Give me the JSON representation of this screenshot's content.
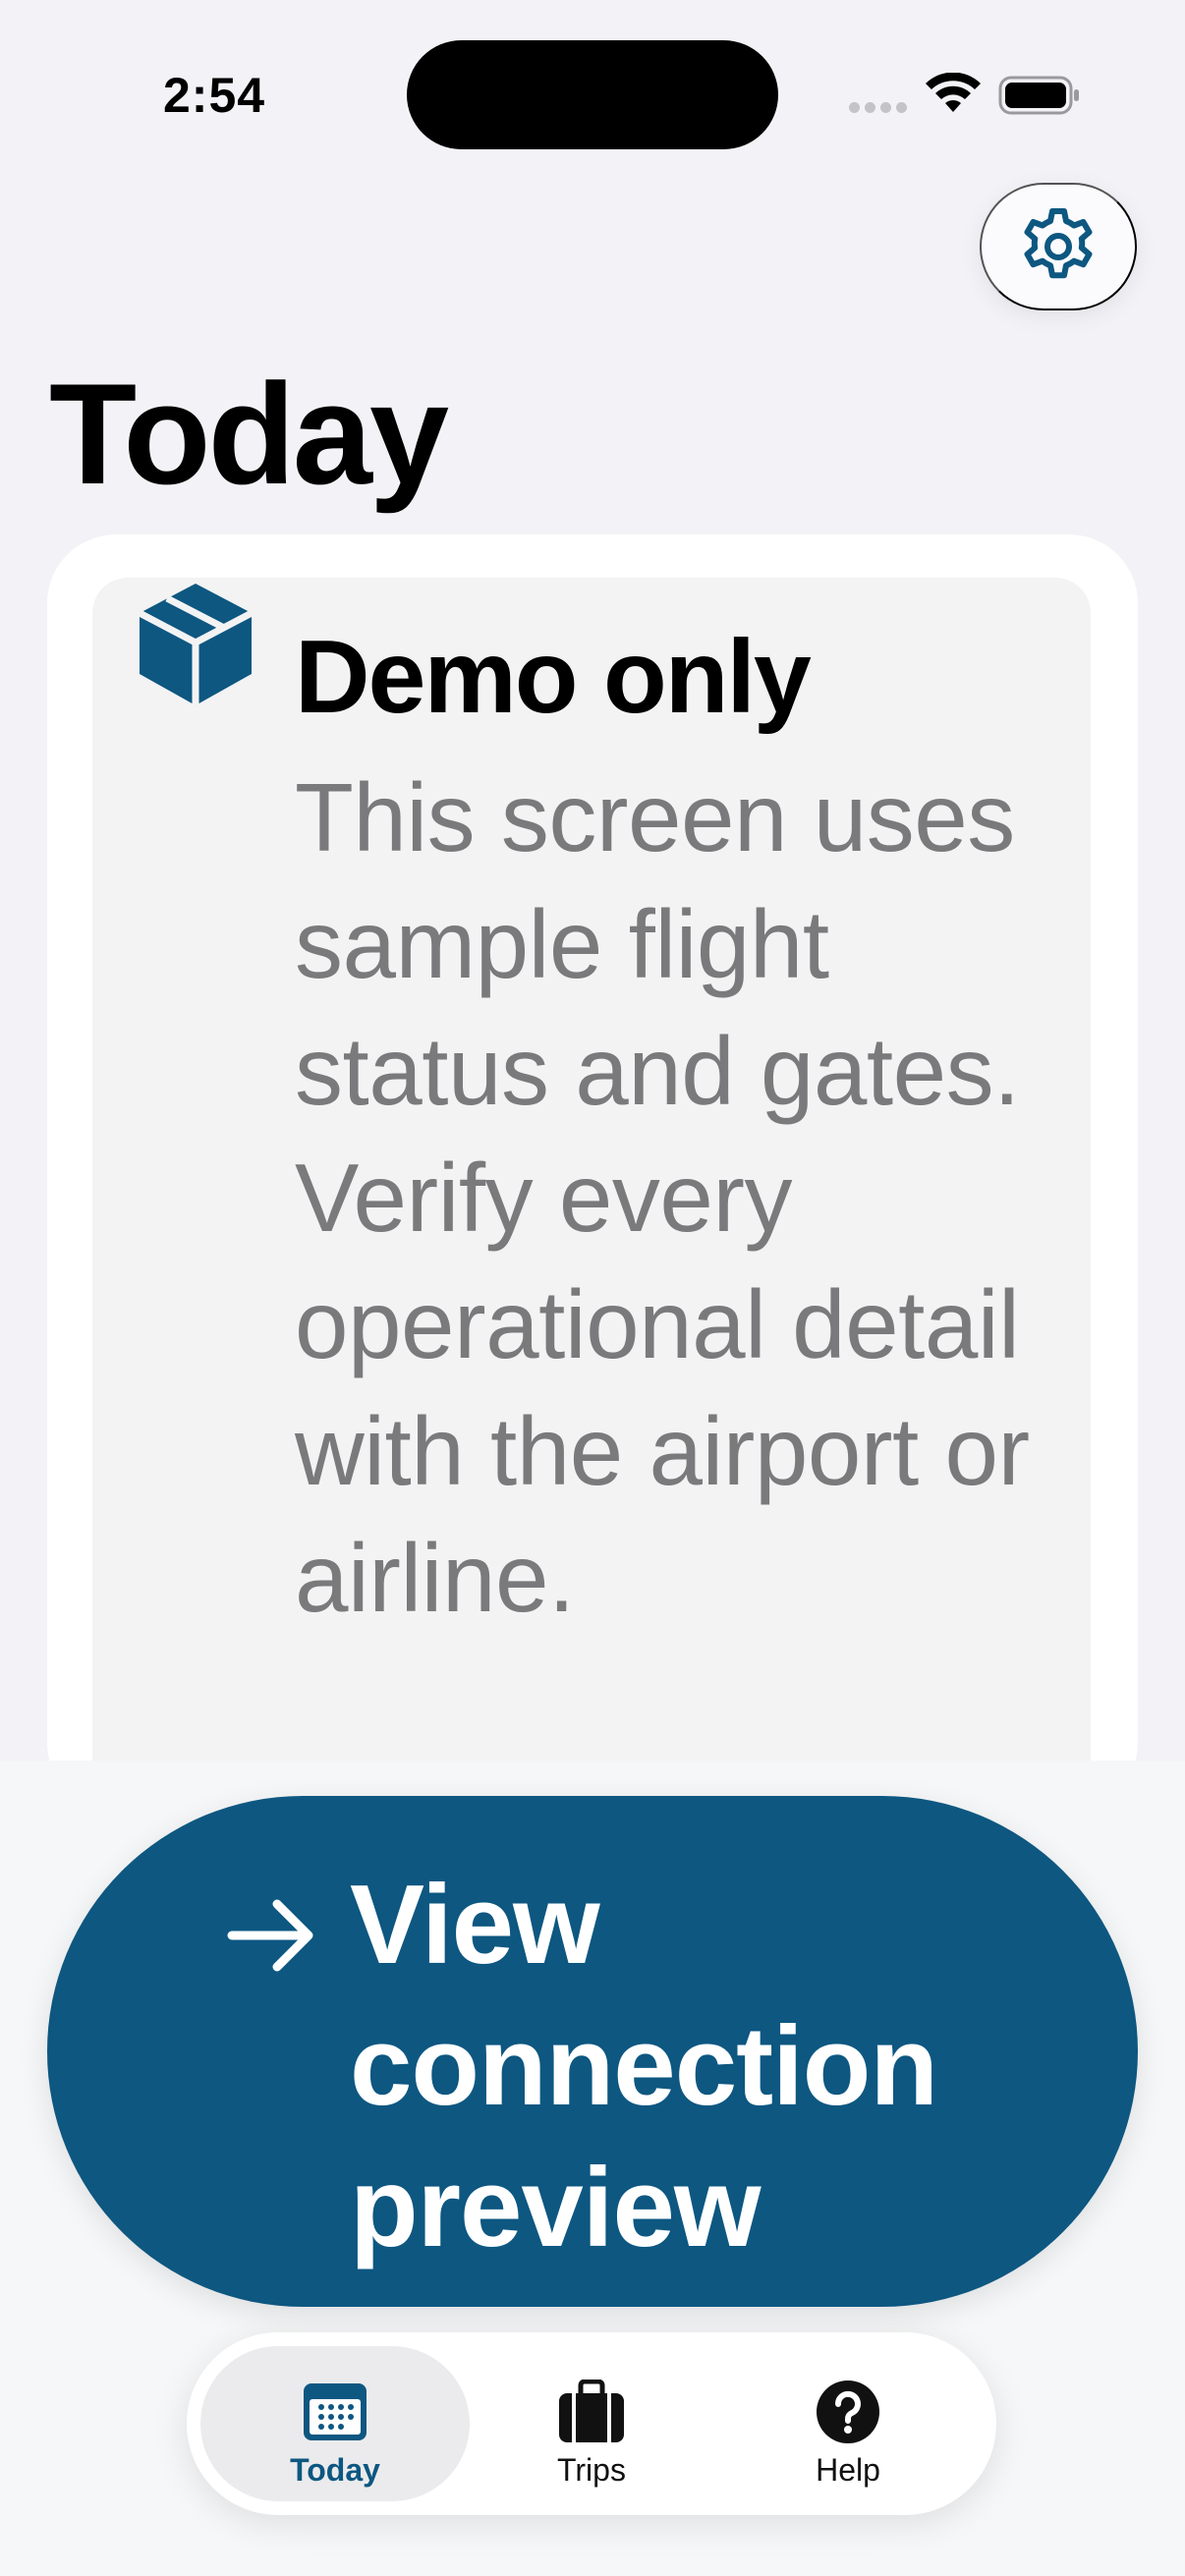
{
  "status_bar": {
    "time": "2:54"
  },
  "header": {
    "settings_icon": "gear-icon",
    "title": "Today"
  },
  "notice_card": {
    "icon": "package-box-icon",
    "title": "Demo only",
    "body": "This screen uses sample flight status and gates. Verify every operational detail with the airport or airline."
  },
  "primary_action": {
    "icon": "arrow-right-icon",
    "label": "View connection preview"
  },
  "tab_bar": {
    "items": [
      {
        "label": "Today",
        "icon": "calendar-icon",
        "selected": true
      },
      {
        "label": "Trips",
        "icon": "suitcase-icon",
        "selected": false
      },
      {
        "label": "Help",
        "icon": "question-circle-icon",
        "selected": false
      }
    ]
  },
  "colors": {
    "accent": "#0d5781",
    "background": "#f2f2f7",
    "body_text": "#7a7a7c"
  }
}
